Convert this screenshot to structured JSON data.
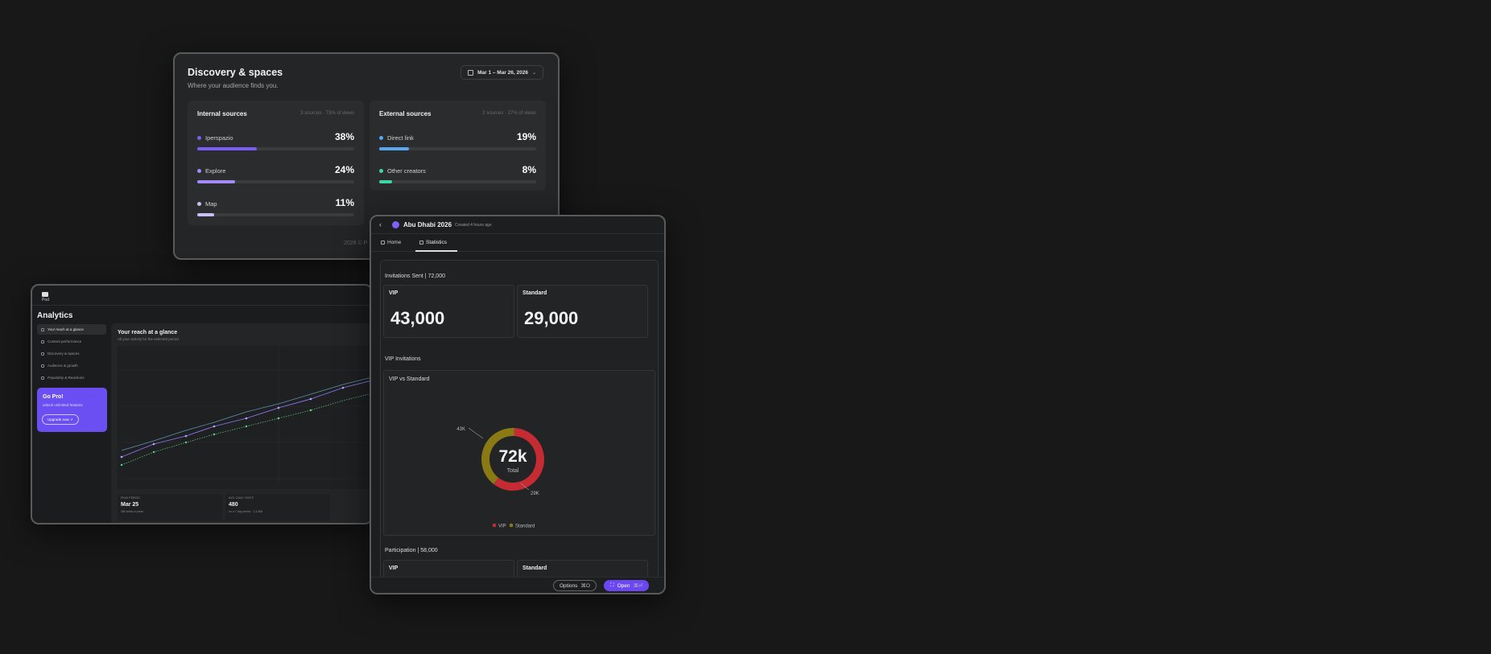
{
  "discovery": {
    "title": "Discovery & spaces",
    "subtitle": "Where your audience finds you.",
    "date_range": "Mar 1 – Mar 26, 2026",
    "internal": {
      "title": "Internal sources",
      "meta": "3 sources · 73% of views",
      "rows": [
        {
          "label": "Iperspazio",
          "pct": "38%",
          "value": 38,
          "color": "#7b5cf5"
        },
        {
          "label": "Explore",
          "pct": "24%",
          "value": 24,
          "color": "#a28bf7"
        },
        {
          "label": "Map",
          "pct": "11%",
          "value": 11,
          "color": "#c9bdfa"
        }
      ]
    },
    "external": {
      "title": "External sources",
      "meta": "2 sources · 27% of views",
      "rows": [
        {
          "label": "Direct link",
          "pct": "19%",
          "value": 19,
          "color": "#5aa6ee"
        },
        {
          "label": "Other creators",
          "pct": "8%",
          "value": 8,
          "color": "#3fd6a2"
        }
      ]
    },
    "footer": "2026 © P"
  },
  "analytics": {
    "logo_text": "Pod",
    "title": "Analytics",
    "nav": [
      {
        "label": "Your reach at a glance",
        "active": true
      },
      {
        "label": "Content performance",
        "active": false
      },
      {
        "label": "Discovery & spaces",
        "active": false
      },
      {
        "label": "Audience & growth",
        "active": false
      },
      {
        "label": "Popularity & Reactions",
        "active": false
      }
    ],
    "promo": {
      "title": "Go Pro!",
      "subtitle": "unlock unlimited features",
      "button": "Upgrade now ↗"
    },
    "main_title": "Your reach at a glance",
    "main_subtitle": "All your activity for the selected period",
    "stats": [
      {
        "label": "PEAK PERIOD",
        "value": "Mar 25",
        "sub": "480 visits on peak"
      },
      {
        "label": "AVG. DAILY VISITS",
        "value": "480",
        "sub": "on a 7-day period · 1,3,456"
      }
    ],
    "chart_series_colors": [
      "#8e77f5",
      "#7dc7f0",
      "#61d487"
    ]
  },
  "event": {
    "name": "Abu Dhabi 2026",
    "created": "Created 4 hours ago",
    "tabs": [
      {
        "label": "Home",
        "active": false
      },
      {
        "label": "Statistics",
        "active": true
      }
    ],
    "invitations_section": "Invitations Sent | 72,000",
    "vip_label": "VIP",
    "vip_value": "43,000",
    "standard_label": "Standard",
    "standard_value": "29,000",
    "vip_invitations_section": "VIP Invitations",
    "chart_title": "VIP vs Standard",
    "donut_center": "72k",
    "donut_center_sub": "Total",
    "label_vip_callout": "43K",
    "label_std_callout": "29K",
    "legend_vip": "VIP",
    "legend_standard": "Standard",
    "participation_section": "Participation | 58,000",
    "participation_vip": "VIP",
    "participation_standard": "Standard",
    "options_label": "Options",
    "options_kbd": "⌘O",
    "open_label": "Open",
    "open_kbd": "⌘⏎",
    "colors": {
      "vip": "#c42b33",
      "standard": "#8a7a14"
    }
  },
  "chart_data": {
    "type": "donut",
    "title": "VIP vs Standard",
    "categories": [
      "VIP",
      "Standard"
    ],
    "values": [
      43000,
      29000
    ]
  }
}
